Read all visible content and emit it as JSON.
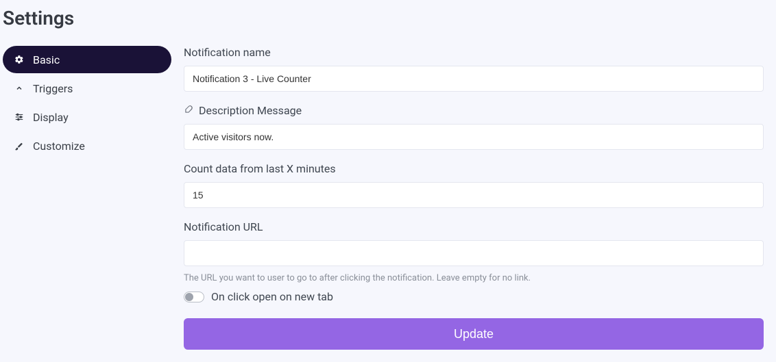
{
  "page": {
    "title": "Settings"
  },
  "sidebar": {
    "items": [
      {
        "label": "Basic"
      },
      {
        "label": "Triggers"
      },
      {
        "label": "Display"
      },
      {
        "label": "Customize"
      }
    ]
  },
  "form": {
    "name": {
      "label": "Notification name",
      "value": "Notification 3 - Live Counter"
    },
    "description": {
      "label": "Description Message",
      "value": "Active visitors now."
    },
    "count": {
      "label": "Count data from last X minutes",
      "value": "15"
    },
    "url": {
      "label": "Notification URL",
      "value": "",
      "help": "The URL you want to user to go to after clicking the notification. Leave empty for no link."
    },
    "newtab": {
      "label": "On click open on new tab"
    },
    "submit": "Update"
  }
}
